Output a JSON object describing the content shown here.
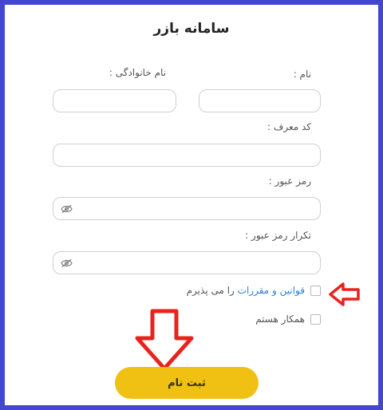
{
  "form": {
    "title": "سامانه بازر",
    "first_name_label": "نام  :",
    "last_name_label": "نام خانوادگی  :",
    "referral_label": "کد معرف  :",
    "password_label": "رمز عبور  :",
    "confirm_password_label": "تکرار رمز عبور  :",
    "first_name_value": "",
    "last_name_value": "",
    "referral_value": "",
    "password_value": "",
    "confirm_password_value": "",
    "terms_link": "قوانین و مقررات",
    "terms_suffix": " را می پذیرم",
    "partner_label": "همکار هستم",
    "submit_label": "ثبت نام"
  },
  "colors": {
    "frame": "#4347cf",
    "accent": "#f0c012",
    "link": "#2f7fd6",
    "annotation": "#e8231c"
  },
  "icons": [
    "eye-slash-icon",
    "arrow-left-annotation",
    "arrow-down-annotation"
  ]
}
